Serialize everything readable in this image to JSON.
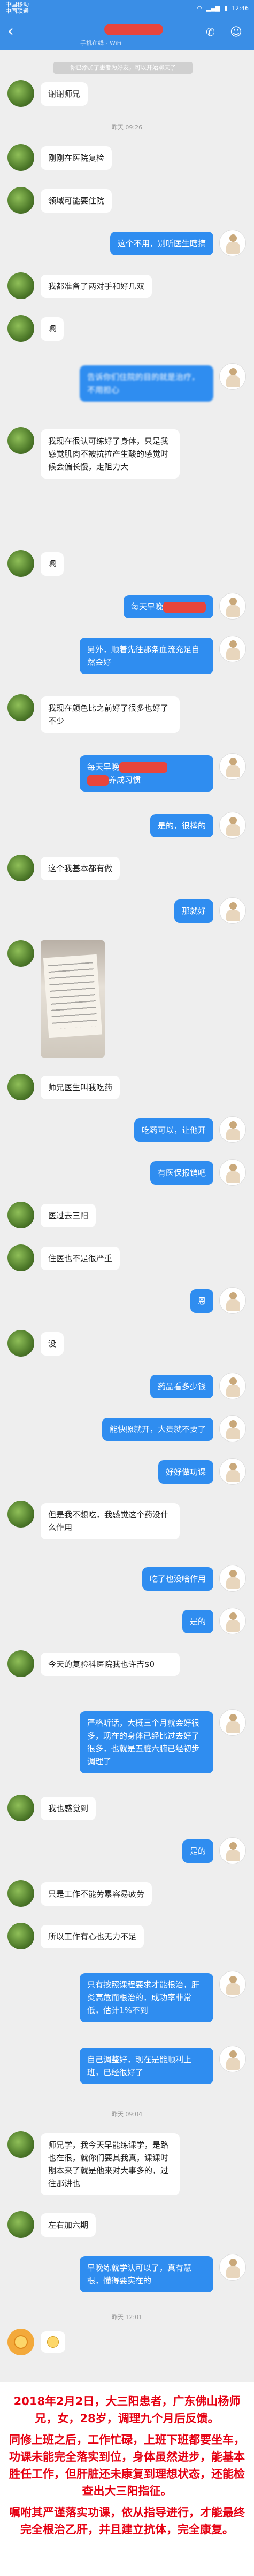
{
  "status_bar": {
    "carrier1": "中国移动",
    "carrier2": "中国联通",
    "time": "12:46",
    "battery": "▮"
  },
  "header": {
    "back": "‹",
    "subtitle": "手机在线 - WiFi",
    "call_icon": "phone-icon",
    "profile_icon": "person-icon"
  },
  "notice": "你已添加了患者为好友，可以开始聊天了",
  "times": [
    "昨天 09:26",
    "昨天 09:04",
    "昨天 12:01"
  ],
  "messages": [
    {
      "side": "left",
      "text": "谢谢师兄"
    },
    {
      "side": "left",
      "text": "刚刚在医院复检"
    },
    {
      "side": "left",
      "text": "领域可能要住院"
    },
    {
      "side": "right",
      "text": "这个不用，别听医生瞎搞"
    },
    {
      "side": "left",
      "text": "我都准备了两对手和好几双"
    },
    {
      "side": "left",
      "text": "嗯"
    },
    {
      "side": "right",
      "text": "告诉你们住院的目的就是治疗，不用担心",
      "blurred": true
    },
    {
      "side": "left",
      "text": "我现在很认可练好了身体，只是我感觉肌肉不被抗拉产生酸的感觉时候会偏长慢，走阻力大"
    },
    {
      "side": "left",
      "text": "嗯"
    },
    {
      "side": "right",
      "text": "每天早晚"
    },
    {
      "side": "right",
      "text": "另外，顺着先往那条血流充足自然会好"
    },
    {
      "side": "left",
      "text": "我现在颜色比之前好了很多也好了不少"
    },
    {
      "side": "right",
      "text": "每天早晚",
      "text2": "养成习惯"
    },
    {
      "side": "right",
      "text": "是的，很棒的"
    },
    {
      "side": "left",
      "text": "这个我基本都有做"
    },
    {
      "side": "right",
      "text": "那就好"
    },
    {
      "side": "left",
      "text": "师兄医生叫我吃药"
    },
    {
      "side": "right",
      "text": "吃药可以，让他开"
    },
    {
      "side": "right",
      "text": "有医保报销吧"
    },
    {
      "side": "left",
      "text": "医过去三阳"
    },
    {
      "side": "left",
      "text": "住医也不是很严重"
    },
    {
      "side": "right",
      "text": "恩"
    },
    {
      "side": "left",
      "text": "没"
    },
    {
      "side": "right",
      "text": "药品看多少钱"
    },
    {
      "side": "right",
      "text": "能快照就开，大贵就不要了"
    },
    {
      "side": "right",
      "text": "好好做功课"
    },
    {
      "side": "left",
      "text": "但是我不想吃，我感觉这个药没什么作用"
    },
    {
      "side": "right",
      "text": "吃了也没啥作用"
    },
    {
      "side": "right",
      "text": "是的"
    },
    {
      "side": "left",
      "text": "今天的复验科医院我也许吉$0"
    },
    {
      "side": "right",
      "text": "严格听话，大概三个月就会好很多，现在的身体已经比过去好了很多，也就是五脏六腑已经初步调理了"
    },
    {
      "side": "left",
      "text": "我也感觉到"
    },
    {
      "side": "right",
      "text": "是的"
    },
    {
      "side": "left",
      "text": "只是工作不能劳累容易疲劳"
    },
    {
      "side": "left",
      "text": "所以工作有心也无力不足"
    },
    {
      "side": "right",
      "text": "只有按照课程要求才能根治，肝炎高危而根治的，成功率非常低，估计1%不到"
    },
    {
      "side": "right",
      "text": "自己调整好，现在是能顺利上班，已经很好了"
    },
    {
      "side": "left",
      "text": "师兄学，我今天早能练课学，是路也在很，就你们要其我真，课课时期本来了就是他来对大事多的，过往那讲也"
    },
    {
      "side": "left",
      "text": "左右加六期"
    },
    {
      "side": "right",
      "text": "早晚练就学认可以了，真有慧根，懂得要实在的"
    }
  ],
  "summary": {
    "p1": "2018年2月2日，大三阳患者，广东佛山杨师兄，女，28岁，调理九个月后反馈。",
    "p2": "同修上班之后，工作忙碌，上班下班都要坐车，功课未能完全落实到位，身体虽然进步，能基本胜任工作，但肝脏还未康复到理想状态，还能检查出大三阳指征。",
    "p3": "嘱咐其严谨落实功课，依从指导进行，才能最终完全根治乙肝，并且建立抗体，完全康复。"
  },
  "colors": {
    "header": "#3a8ee6",
    "bubble_right": "#2f8df0",
    "summary_text": "#e60012"
  }
}
